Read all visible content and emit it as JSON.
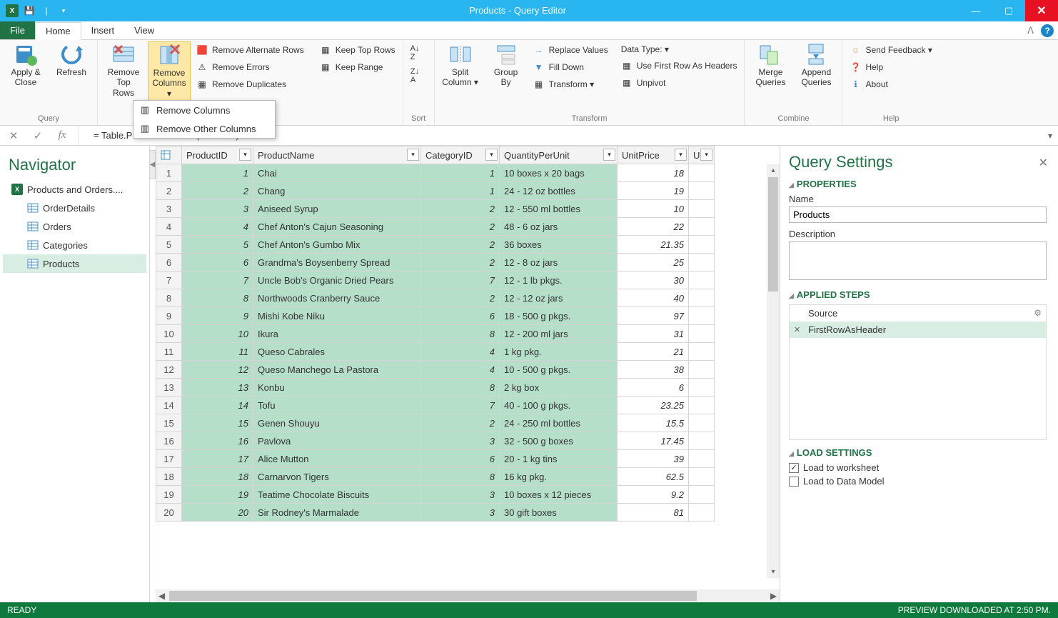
{
  "titlebar": {
    "title": "Products - Query Editor"
  },
  "tabs": {
    "file": "File",
    "home": "Home",
    "insert": "Insert",
    "view": "View"
  },
  "ribbon": {
    "query": {
      "label": "Query",
      "apply_close": "Apply &\nClose",
      "refresh": "Refresh"
    },
    "remove_top_rows": "Remove\nTop Rows",
    "remove_columns": "Remove\nColumns ▾",
    "remove_alt": "Remove Alternate Rows",
    "remove_errors": "Remove Errors",
    "remove_dup": "Remove Duplicates",
    "keep_top": "Keep Top Rows",
    "keep_range": "Keep Range",
    "sort": {
      "label": "Sort"
    },
    "split_col": "Split\nColumn ▾",
    "group_by": "Group\nBy",
    "replace": "Replace Values",
    "fill": "Fill Down",
    "transform_dd": "Transform ▾",
    "datatype": "Data Type:  ▾",
    "first_row": "Use First Row As Headers",
    "unpivot": "Unpivot",
    "transform": {
      "label": "Transform"
    },
    "merge": "Merge\nQueries",
    "append": "Append\nQueries",
    "combine": {
      "label": "Combine"
    },
    "feedback": "Send Feedback ▾",
    "help": "Help",
    "about": "About",
    "help_group": {
      "label": "Help"
    }
  },
  "menu": {
    "remove_cols": "Remove Columns",
    "remove_other": "Remove Other Columns"
  },
  "fx": {
    "formula": "= Table.PromoteHeaders(Products)"
  },
  "navigator": {
    "title": "Navigator",
    "root": "Products and Orders....",
    "items": [
      "OrderDetails",
      "Orders",
      "Categories",
      "Products"
    ]
  },
  "columns": [
    "ProductID",
    "ProductName",
    "CategoryID",
    "QuantityPerUnit",
    "UnitPrice",
    "Unit"
  ],
  "rows": [
    {
      "n": 1,
      "pid": 1,
      "name": "Chai",
      "cat": 1,
      "qpu": "10 boxes x 20 bags",
      "price": "18"
    },
    {
      "n": 2,
      "pid": 2,
      "name": "Chang",
      "cat": 1,
      "qpu": "24 - 12 oz bottles",
      "price": "19"
    },
    {
      "n": 3,
      "pid": 3,
      "name": "Aniseed Syrup",
      "cat": 2,
      "qpu": "12 - 550 ml bottles",
      "price": "10"
    },
    {
      "n": 4,
      "pid": 4,
      "name": "Chef Anton's Cajun Seasoning",
      "cat": 2,
      "qpu": "48 - 6 oz jars",
      "price": "22"
    },
    {
      "n": 5,
      "pid": 5,
      "name": "Chef Anton's Gumbo Mix",
      "cat": 2,
      "qpu": "36 boxes",
      "price": "21.35"
    },
    {
      "n": 6,
      "pid": 6,
      "name": "Grandma's Boysenberry Spread",
      "cat": 2,
      "qpu": "12 - 8 oz jars",
      "price": "25"
    },
    {
      "n": 7,
      "pid": 7,
      "name": "Uncle Bob's Organic Dried Pears",
      "cat": 7,
      "qpu": "12 - 1 lb pkgs.",
      "price": "30"
    },
    {
      "n": 8,
      "pid": 8,
      "name": "Northwoods Cranberry Sauce",
      "cat": 2,
      "qpu": "12 - 12 oz jars",
      "price": "40"
    },
    {
      "n": 9,
      "pid": 9,
      "name": "Mishi Kobe Niku",
      "cat": 6,
      "qpu": "18 - 500 g pkgs.",
      "price": "97"
    },
    {
      "n": 10,
      "pid": 10,
      "name": "Ikura",
      "cat": 8,
      "qpu": "12 - 200 ml jars",
      "price": "31"
    },
    {
      "n": 11,
      "pid": 11,
      "name": "Queso Cabrales",
      "cat": 4,
      "qpu": "1 kg pkg.",
      "price": "21"
    },
    {
      "n": 12,
      "pid": 12,
      "name": "Queso Manchego La Pastora",
      "cat": 4,
      "qpu": "10 - 500 g pkgs.",
      "price": "38"
    },
    {
      "n": 13,
      "pid": 13,
      "name": "Konbu",
      "cat": 8,
      "qpu": "2 kg box",
      "price": "6"
    },
    {
      "n": 14,
      "pid": 14,
      "name": "Tofu",
      "cat": 7,
      "qpu": "40 - 100 g pkgs.",
      "price": "23.25"
    },
    {
      "n": 15,
      "pid": 15,
      "name": "Genen Shouyu",
      "cat": 2,
      "qpu": "24 - 250 ml bottles",
      "price": "15.5"
    },
    {
      "n": 16,
      "pid": 16,
      "name": "Pavlova",
      "cat": 3,
      "qpu": "32 - 500 g boxes",
      "price": "17.45"
    },
    {
      "n": 17,
      "pid": 17,
      "name": "Alice Mutton",
      "cat": 6,
      "qpu": "20 - 1 kg tins",
      "price": "39"
    },
    {
      "n": 18,
      "pid": 18,
      "name": "Carnarvon Tigers",
      "cat": 8,
      "qpu": "16 kg pkg.",
      "price": "62.5"
    },
    {
      "n": 19,
      "pid": 19,
      "name": "Teatime Chocolate Biscuits",
      "cat": 3,
      "qpu": "10 boxes x 12 pieces",
      "price": "9.2"
    },
    {
      "n": 20,
      "pid": 20,
      "name": "Sir Rodney's Marmalade",
      "cat": 3,
      "qpu": "30 gift boxes",
      "price": "81"
    }
  ],
  "qs": {
    "title": "Query Settings",
    "properties": "PROPERTIES",
    "name_lbl": "Name",
    "name_val": "Products",
    "desc_lbl": "Description",
    "applied": "APPLIED STEPS",
    "steps": [
      "Source",
      "FirstRowAsHeader"
    ],
    "load": "LOAD SETTINGS",
    "load_ws": "Load to worksheet",
    "load_dm": "Load to Data Model"
  },
  "status": {
    "ready": "READY",
    "preview": "PREVIEW DOWNLOADED AT 2:50 PM."
  }
}
